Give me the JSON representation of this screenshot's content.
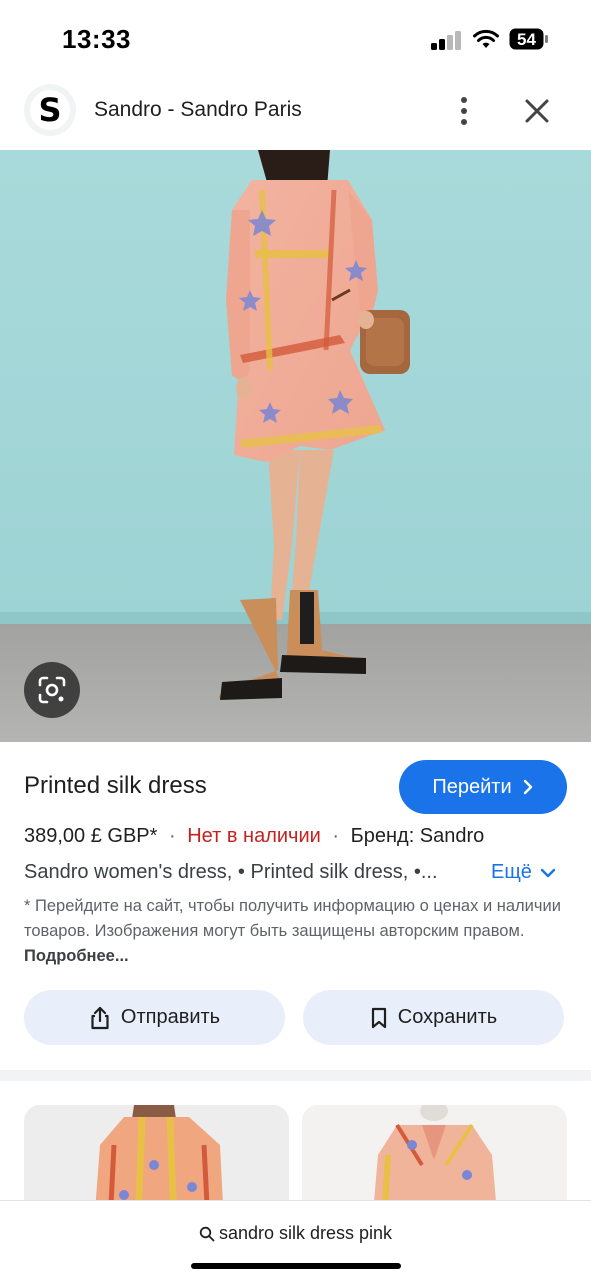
{
  "status_bar": {
    "time": "13:33",
    "battery": "54"
  },
  "header": {
    "logo_letter": "S",
    "title": "Sandro - Sandro Paris",
    "menu_icon": "more-vert-icon",
    "close_icon": "close-icon"
  },
  "hero": {
    "lens_icon": "google-lens-icon"
  },
  "product": {
    "title": "Printed silk dress",
    "go_button_label": "Перейти",
    "price": "389,00 £ GBP*",
    "separator": "·",
    "stock_status": "Нет в наличии",
    "brand": "Бренд: Sandro",
    "tags": "Sandro women's dress, • Printed silk dress, •...",
    "more_label": "Ещё",
    "disclaimer": "* Перейдите на сайт, чтобы получить информацию о ценах и наличии товаров. Изображения могут быть защищены авторским правом.",
    "disclaimer_link": "Подробнее..."
  },
  "actions": {
    "share_label": "Отправить",
    "save_label": "Сохранить"
  },
  "search": {
    "query": "sandro silk dress pink"
  },
  "colors": {
    "accent": "#1a73e8",
    "out_of_stock": "#c5221f",
    "button_bg": "#e8effb"
  }
}
